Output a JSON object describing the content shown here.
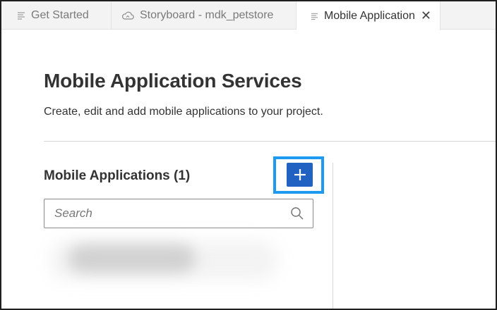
{
  "tabs": [
    {
      "label": "Get Started",
      "icon": "lines-icon"
    },
    {
      "label": "Storyboard - mdk_petstore",
      "icon": "cloud-icon"
    },
    {
      "label": "Mobile Application",
      "icon": "lines-icon",
      "active": true,
      "close": "✕"
    }
  ],
  "page": {
    "title": "Mobile Application Services",
    "subtitle": "Create, edit and add mobile applications to your project."
  },
  "apps": {
    "section_title": "Mobile Applications (1)",
    "add_button": {
      "symbol": "+",
      "highlight_color": "#1e9bf0",
      "color": "#2161c2"
    },
    "search": {
      "placeholder": "Search",
      "value": ""
    }
  }
}
